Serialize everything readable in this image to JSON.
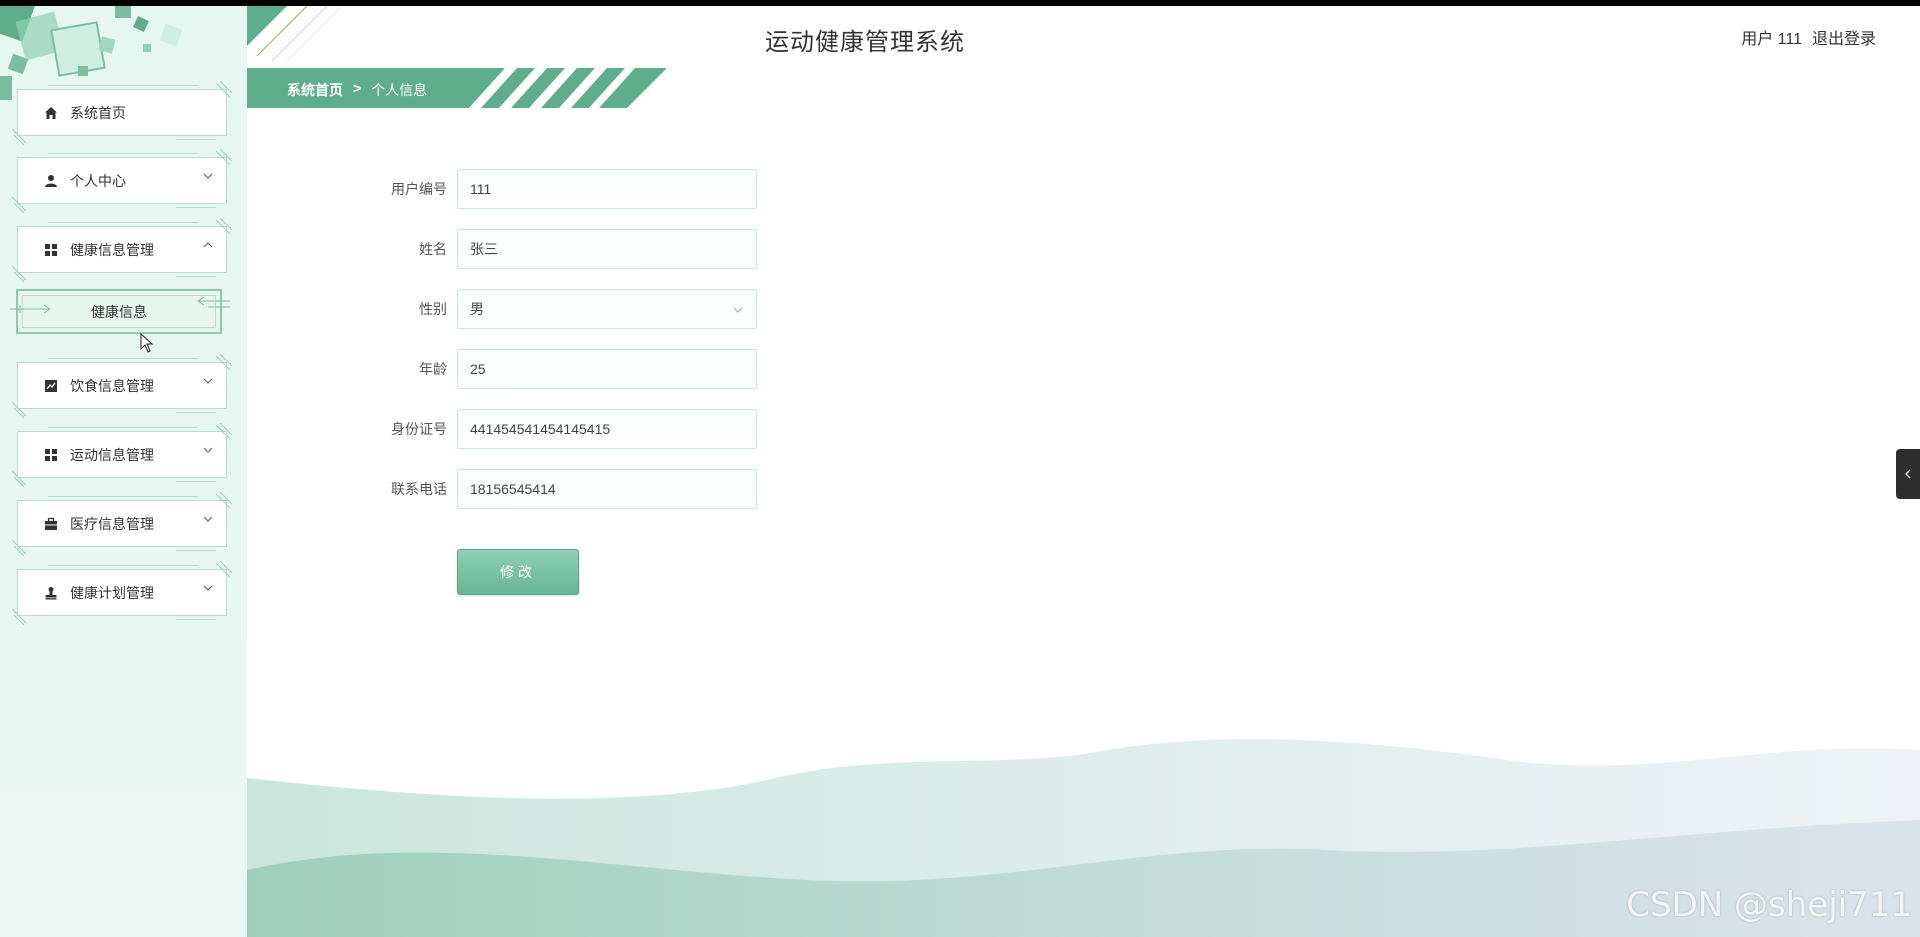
{
  "header": {
    "title": "运动健康管理系统",
    "user_label": "用户 111",
    "logout_label": "退出登录"
  },
  "breadcrumb": {
    "home": "系统首页",
    "separator": ">",
    "current": "个人信息"
  },
  "sidebar": {
    "items": [
      {
        "label": "系统首页",
        "icon": "home-icon"
      },
      {
        "label": "个人中心",
        "icon": "user-icon"
      },
      {
        "label": "健康信息管理",
        "icon": "grid-icon"
      },
      {
        "label": "饮食信息管理",
        "icon": "chart-icon"
      },
      {
        "label": "运动信息管理",
        "icon": "grid-icon"
      },
      {
        "label": "医疗信息管理",
        "icon": "briefcase-icon"
      },
      {
        "label": "健康计划管理",
        "icon": "stamp-icon"
      }
    ],
    "submenu": {
      "label": "健康信息"
    }
  },
  "form": {
    "fields": [
      {
        "label": "用户编号",
        "value": "111"
      },
      {
        "label": "姓名",
        "value": "张三"
      },
      {
        "label": "性别",
        "value": "男"
      },
      {
        "label": "年龄",
        "value": "25"
      },
      {
        "label": "身份证号",
        "value": "441454541454145415"
      },
      {
        "label": "联系电话",
        "value": "18156545414"
      }
    ],
    "submit_label": "修改"
  },
  "watermark": "CSDN @sheji711",
  "colors": {
    "accent": "#5eae8e",
    "sidebar_bg": "#e6f6f0",
    "border": "#b9dccd"
  }
}
